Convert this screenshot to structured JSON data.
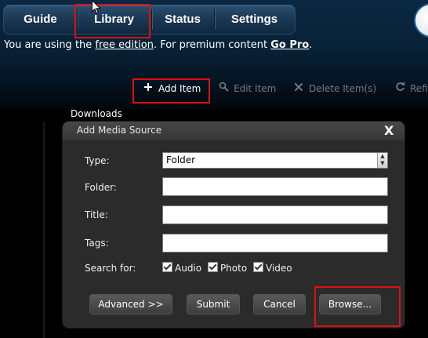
{
  "nav": {
    "tabs": [
      {
        "label": "Guide"
      },
      {
        "label": "Library"
      },
      {
        "label": "Status"
      },
      {
        "label": "Settings"
      }
    ]
  },
  "edition": {
    "prefix": "You are using the ",
    "free_link": "free edition",
    "middle": ". For premium content ",
    "pro_link": "Go Pro",
    "suffix": "."
  },
  "toolbar": {
    "add": "Add Item",
    "edit": "Edit Item",
    "delete": "Delete Item(s)",
    "refresh": "Refi"
  },
  "list": {
    "downloads": "Downloads"
  },
  "dialog": {
    "title": "Add Media Source",
    "close": "X",
    "type_label": "Type:",
    "type_value": "Folder",
    "folder_label": "Folder:",
    "title_label": "Title:",
    "tags_label": "Tags:",
    "search_label": "Search for:",
    "options": [
      {
        "label": "Audio",
        "checked": true
      },
      {
        "label": "Photo",
        "checked": true
      },
      {
        "label": "Video",
        "checked": true
      }
    ],
    "buttons": {
      "advanced": "Advanced >>",
      "submit": "Submit",
      "cancel": "Cancel",
      "browse": "Browse..."
    }
  },
  "colors": {
    "highlight": "#dd1111",
    "nav_bg": "#1a3753",
    "dialog_bg": "#2b2b2b"
  }
}
